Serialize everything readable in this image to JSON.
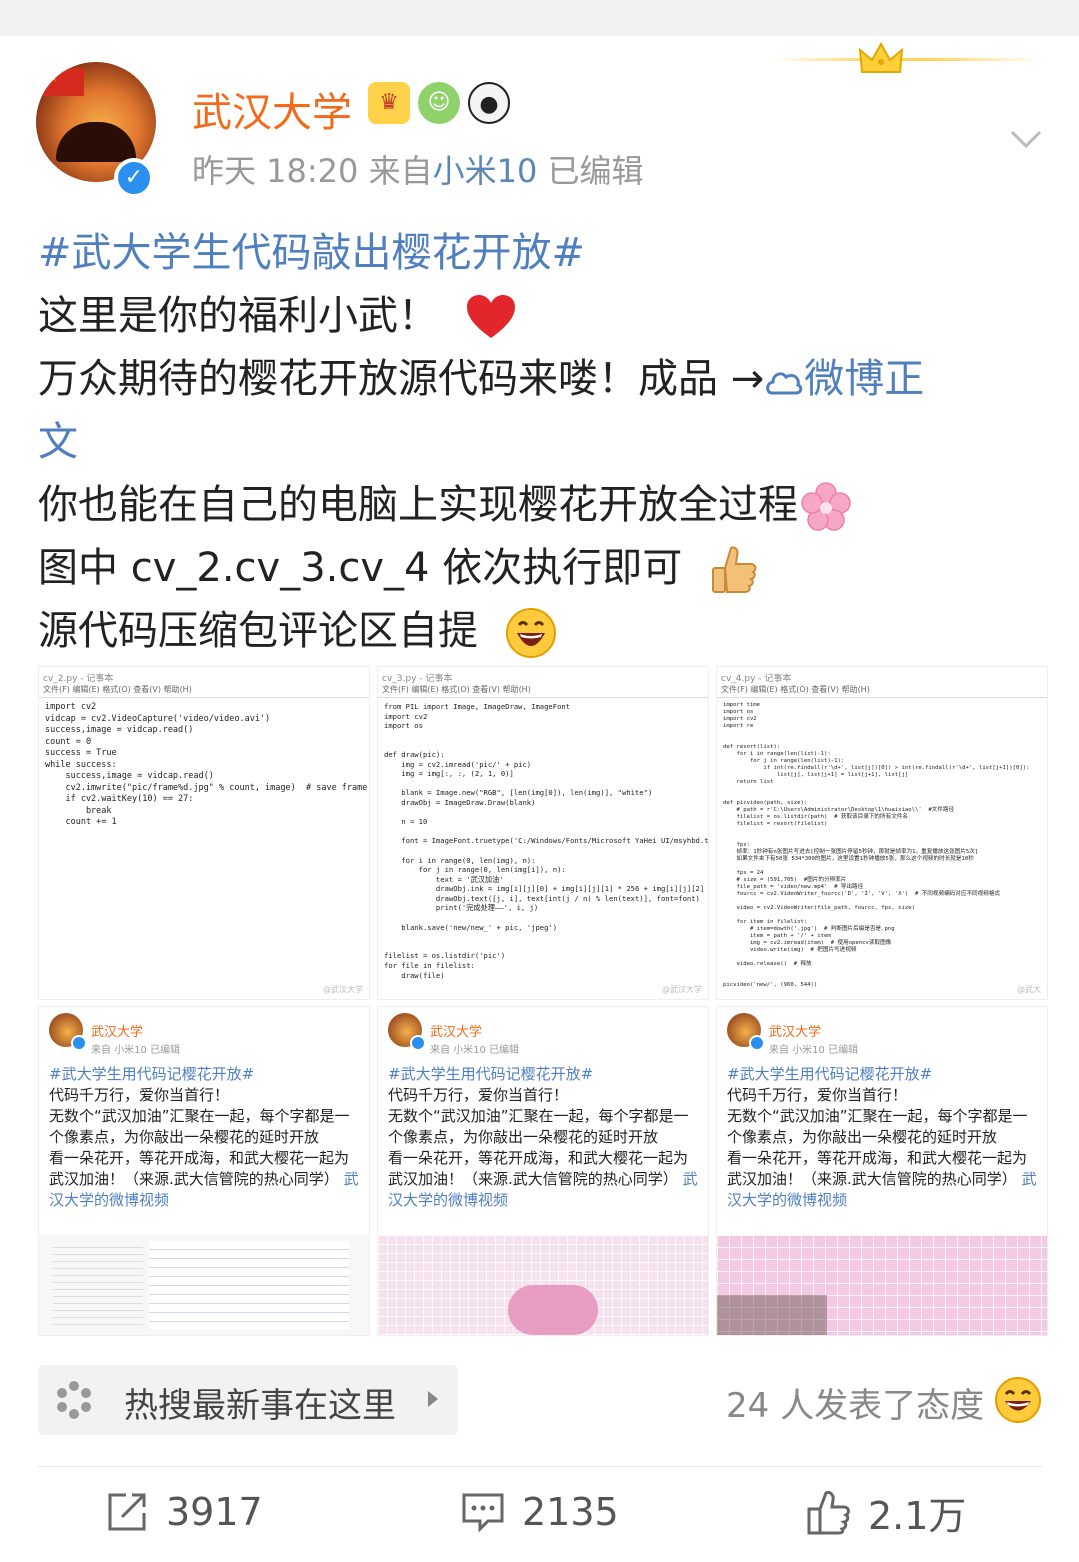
{
  "post": {
    "username": "武汉大学",
    "time": "昨天 18:20",
    "from_label": "来自",
    "source": "小米10",
    "edited": "已编辑",
    "lines": {
      "hashtag": "#武大学生代码敲出樱花开放#",
      "l1": "这里是你的福利小武！",
      "l2a": "万众期待的樱花开放源代码来喽！成品 →",
      "l2b": "微博正",
      "l2c": "文",
      "l3": "你也能在自己的电脑上实现樱花开放全过程",
      "l4": "图中 cv_2.cv_3.cv_4 依次执行即可",
      "l5": "源代码压缩包评论区自提"
    }
  },
  "images": {
    "code1": {
      "title": "cv_2.py - 记事本",
      "menu": "文件(F)  编辑(E)  格式(O)  查看(V)  帮助(H)",
      "code": "import cv2\nvidcap = cv2.VideoCapture('video/video.avi')\nsuccess,image = vidcap.read()\ncount = 0\nsuccess = True\nwhile success:\n    success,image = vidcap.read()\n    cv2.imwrite(\"pic/frame%d.jpg\" % count, image)  # save frame as JPEG file\n    if cv2.waitKey(10) == 27:\n        break\n    count += 1"
    },
    "code2": {
      "title": "cv_3.py - 记事本",
      "menu": "文件(F)  编辑(E)  格式(O)  查看(V)  帮助(H)",
      "code": "from PIL import Image, ImageDraw, ImageFont\nimport cv2\nimport os\n\n\ndef draw(pic):\n    img = cv2.imread('pic/' + pic)\n    img = img[:, :, (2, 1, 0)]\n\n    blank = Image.new(\"RGB\", [len(img[0]), len(img)], \"white\")\n    drawObj = ImageDraw.Draw(blank)\n\n    n = 10\n\n    font = ImageFont.truetype('C:/Windows/Fonts/Microsoft YaHei UI/msyhbd.ttc', size=n - 1)\n\n    for i in range(0, len(img), n):\n        for j in range(0, len(img[i]), n):\n            text = '武汉加油'\n            drawObj.ink = img[i][j][0] + img[i][j][1] * 256 + img[i][j][2] * 256 * 256\n            drawObj.text([j, i], text[int(j / n) % len(text)], font=font)\n            print('完成处理——', i, j)\n\n    blank.save('new/new_' + pic, 'jpeg')\n\n\nfilelist = os.listdir('pic')\nfor file in filelist:\n    draw(file)"
    },
    "code3": {
      "title": "cv_4.py - 记事本",
      "menu": "文件(F)  编辑(E)  格式(O)  查看(V)  帮助(H)",
      "code": "import time\nimport os\nimport cv2\nimport re\n\n\ndef resort(list):\n    for i in range(len(list)-1):\n        for j in range(len(list)-1):\n            if int(re.findall(r'\\d+', list[j])[0]) > int(re.findall(r'\\d+', list[j+1])[0]):\n                list[j], list[j+1] = list[j+1], list[j]\n    return list\n\n\ndef picvideo(path, size):\n    # path = r'C:\\Users\\Administrator\\Desktop\\1\\huaixiao\\\\'  #文件路径\n    filelist = os.listdir(path)  # 获取该目录下的所有文件名\n    filelist = resort(filelist)\n\n\n    fps:\n    帧率：1秒钟有n张图片写进去[控制一张图片停留5秒钟，那就是帧率为1，重复播放这张图片5次]\n    如果文件夹下有50张 534*300的图片，这里设置1秒钟播放5张，那么这个视频的时长就是10秒\n    \n    fps = 24\n    # size = (591,705)  #图片的分辨率片\n    file_path = 'video/new.mp4'  # 导出路径\n    fourcc = cv2.VideoWriter_fourcc('D', 'I', 'V', 'X')  # 不同视频编码对应不同视频格式\n\n    video = cv2.VideoWriter(file_path, fourcc, fps, size)\n\n    for item in filelist:\n        # item=dowth('.jpg')  # 判断图片后缀是否是.png\n        item = path + '/' + item\n        img = cv2.imread(item)  # 使用opencv读取图像\n        video.write(img)  # 把图片写进视频\n\n    video.release()  # 释放\n\n\npicvideo('new/', (960, 544))"
    },
    "watermark1": "@武汉大学",
    "watermark2": "@武汉大学",
    "watermark3": "@武大",
    "mini": {
      "username": "武汉大学",
      "from_label": "来自",
      "source": "小米10",
      "edited": "已编辑",
      "hashtag": "#武大学生用代码记樱花开放#",
      "l1": "代码千万行，爱你当首行！",
      "l2": "无数个“武汉加油”汇聚在一起，每个字都是一个像素点，为你敲出一朵樱花的延时开放",
      "l3": "看一朵花开，等花开成海，和武大樱花一起为武汉加油！（来源.武大信管院的热心同学）",
      "link": "武汉大学的微博视频"
    }
  },
  "hot": {
    "label": "热搜最新事在这里"
  },
  "reactions": {
    "text": "24 人发表了态度"
  },
  "actions": {
    "repost": "3917",
    "comment": "2135",
    "like": "2.1万"
  },
  "colors": {
    "username": "#f26a1a",
    "link": "#4f7fbf",
    "meta": "#999999",
    "verified": "#2b8ff0"
  },
  "icons": [
    "crown-icon",
    "verified-icon",
    "vip-badge-icon",
    "frog-badge-icon",
    "panda-badge-icon",
    "chevron-down-icon",
    "heart-icon",
    "weibo-link-icon",
    "cherry-blossom-icon",
    "thumbs-up-icon",
    "grin-icon",
    "hot-search-icon",
    "smile-icon",
    "repost-icon",
    "comment-icon",
    "like-icon"
  ]
}
